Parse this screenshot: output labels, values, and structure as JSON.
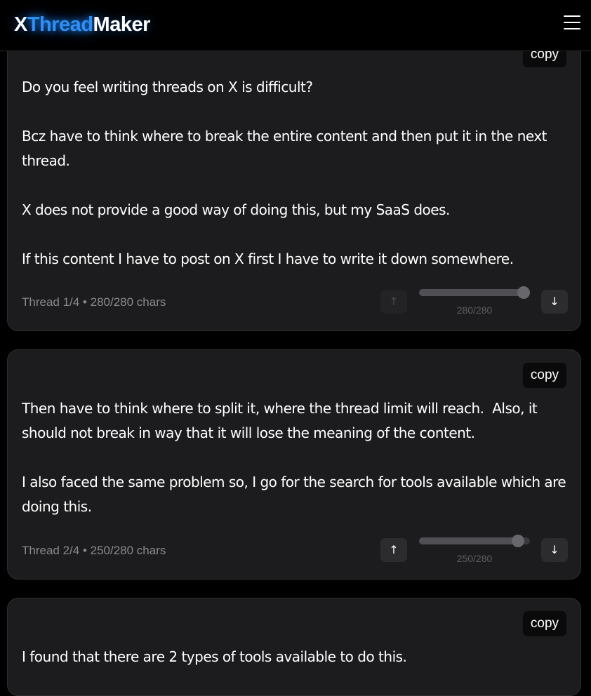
{
  "app": {
    "logo_prefix": "X",
    "logo_accent": "Thread",
    "logo_suffix": "Maker",
    "menu_icon": "hamburger-menu-icon",
    "accent_color": "#2e8ff5"
  },
  "cards": [
    {
      "copy_label": "copy",
      "text": "Do you feel writing threads on X is difficult?\n\nBcz have to think where to break the entire content and then put it in the next thread.\n\nX does not provide a good way of doing this, but my SaaS does.\n\nIf this content I have to post on X first I have to write it down somewhere.",
      "meta": "Thread 1/4 • 280/280 chars",
      "slider_label": "280/280",
      "slider_fraction": 1.0,
      "up_icon": "↑",
      "down_icon": "↓",
      "up_disabled": true
    },
    {
      "copy_label": "copy",
      "text": "Then have to think where to split it, where the thread limit will reach.  Also, it should not break in way that it will lose the meaning of the content.\n\nI also faced the same problem so, I go for the search for tools available which are doing this.",
      "meta": "Thread 2/4 • 250/280 chars",
      "slider_label": "250/280",
      "slider_fraction": 0.893,
      "up_icon": "↑",
      "down_icon": "↓",
      "up_disabled": false
    },
    {
      "copy_label": "copy",
      "text": "I found that there are 2 types of tools available to do this."
    }
  ]
}
